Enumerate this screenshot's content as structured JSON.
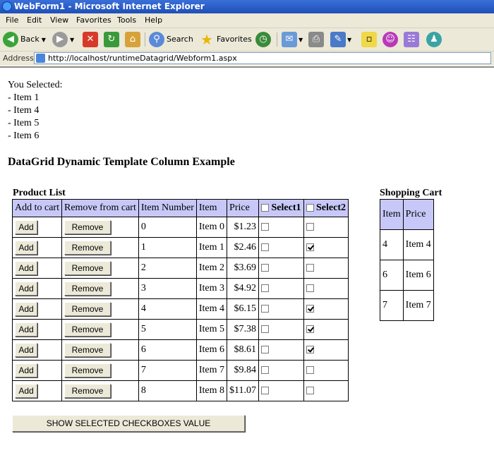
{
  "window": {
    "title": "WebForm1 - Microsoft Internet Explorer"
  },
  "menu": [
    "File",
    "Edit",
    "View",
    "Favorites",
    "Tools",
    "Help"
  ],
  "toolbar": {
    "back": "Back",
    "search": "Search",
    "favorites": "Favorites"
  },
  "address": {
    "label": "Address",
    "url": "http://localhost/runtimeDatagrid/Webform1.aspx"
  },
  "page": {
    "you_selected": "You Selected:",
    "selected_items": [
      "- Item 1",
      "- Item 4",
      "- Item 5",
      "- Item 6"
    ],
    "heading": "DataGrid Dynamic Template Column Example",
    "product_list_label": "Product List",
    "shopping_cart_label": "Shopping Cart",
    "show_button": "SHOW SELECTED CHECKBOXES VALUE"
  },
  "product_grid": {
    "headers": [
      "Add to cart",
      "Remove from cart",
      "Item Number",
      "Item",
      "Price",
      "Select1",
      "Select2"
    ],
    "add_label": "Add",
    "remove_label": "Remove",
    "rows": [
      {
        "number": "0",
        "item": "Item 0",
        "price": "$1.23",
        "select1": false,
        "select2": false
      },
      {
        "number": "1",
        "item": "Item 1",
        "price": "$2.46",
        "select1": false,
        "select2": true
      },
      {
        "number": "2",
        "item": "Item 2",
        "price": "$3.69",
        "select1": false,
        "select2": false
      },
      {
        "number": "3",
        "item": "Item 3",
        "price": "$4.92",
        "select1": false,
        "select2": false
      },
      {
        "number": "4",
        "item": "Item 4",
        "price": "$6.15",
        "select1": false,
        "select2": true
      },
      {
        "number": "5",
        "item": "Item 5",
        "price": "$7.38",
        "select1": false,
        "select2": true
      },
      {
        "number": "6",
        "item": "Item 6",
        "price": "$8.61",
        "select1": false,
        "select2": true
      },
      {
        "number": "7",
        "item": "Item 7",
        "price": "$9.84",
        "select1": false,
        "select2": false
      },
      {
        "number": "8",
        "item": "Item 8",
        "price": "$11.07",
        "select1": false,
        "select2": false
      }
    ]
  },
  "cart_grid": {
    "headers": [
      "Item",
      "Price"
    ],
    "rows": [
      {
        "item": "4",
        "price": "Item 4"
      },
      {
        "item": "6",
        "price": "Item 6"
      },
      {
        "item": "7",
        "price": "Item 7"
      }
    ]
  }
}
